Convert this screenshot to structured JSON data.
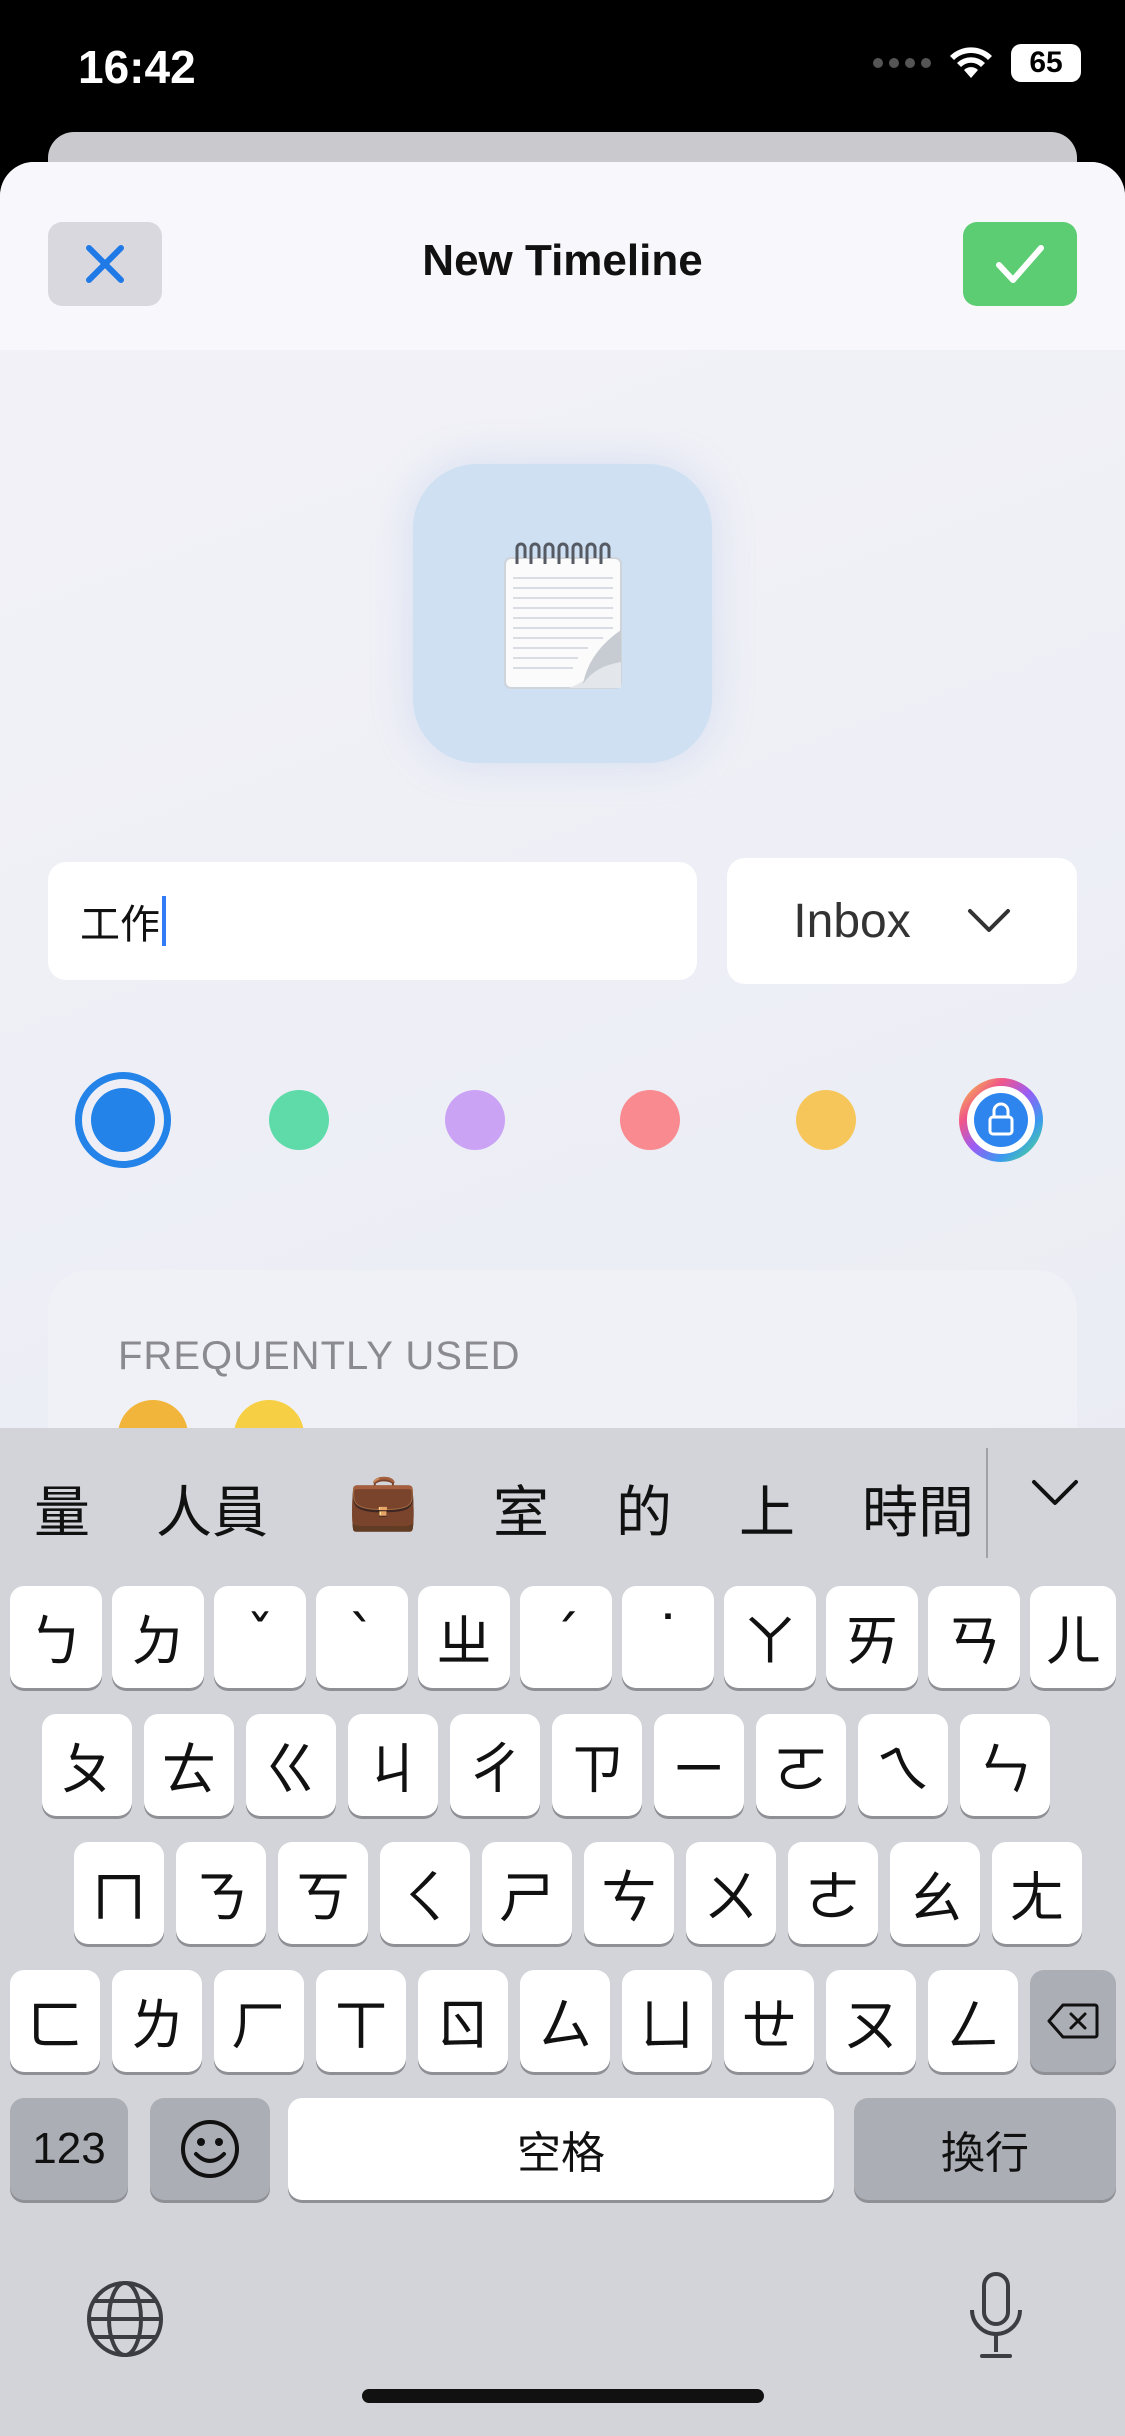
{
  "status": {
    "time": "16:42",
    "battery": "65"
  },
  "nav": {
    "title": "New Timeline"
  },
  "form": {
    "name_value": "工作",
    "folder": "Inbox"
  },
  "colors": [
    {
      "name": "blue",
      "hex": "#2383e8",
      "selected": true
    },
    {
      "name": "green",
      "hex": "#5edba8"
    },
    {
      "name": "purple",
      "hex": "#caa3f5"
    },
    {
      "name": "red",
      "hex": "#f98a8f"
    },
    {
      "name": "yellow",
      "hex": "#f6c65a"
    },
    {
      "name": "custom-locked",
      "icon": "lock-icon"
    }
  ],
  "emoji": {
    "section_header": "FREQUENTLY USED"
  },
  "candidates": [
    "量",
    "人員",
    "💼",
    "室",
    "的",
    "上",
    "時間"
  ],
  "keyboard": {
    "row1": [
      "ㄅ",
      "ㄉ",
      "ˇ",
      "ˋ",
      "ㄓ",
      "ˊ",
      "˙",
      "ㄚ",
      "ㄞ",
      "ㄢ",
      "ㄦ"
    ],
    "row2": [
      "ㄆ",
      "ㄊ",
      "ㄍ",
      "ㄐ",
      "ㄔ",
      "ㄗ",
      "ㄧ",
      "ㄛ",
      "ㄟ",
      "ㄣ"
    ],
    "row3": [
      "ㄇ",
      "ㄋ",
      "ㄎ",
      "ㄑ",
      "ㄕ",
      "ㄘ",
      "ㄨ",
      "ㄜ",
      "ㄠ",
      "ㄤ"
    ],
    "row4": [
      "ㄈ",
      "ㄌ",
      "ㄏ",
      "ㄒ",
      "ㄖ",
      "ㄙ",
      "ㄩ",
      "ㄝ",
      "ㄡ",
      "ㄥ"
    ],
    "numbers_label": "123",
    "space_label": "空格",
    "return_label": "換行"
  }
}
